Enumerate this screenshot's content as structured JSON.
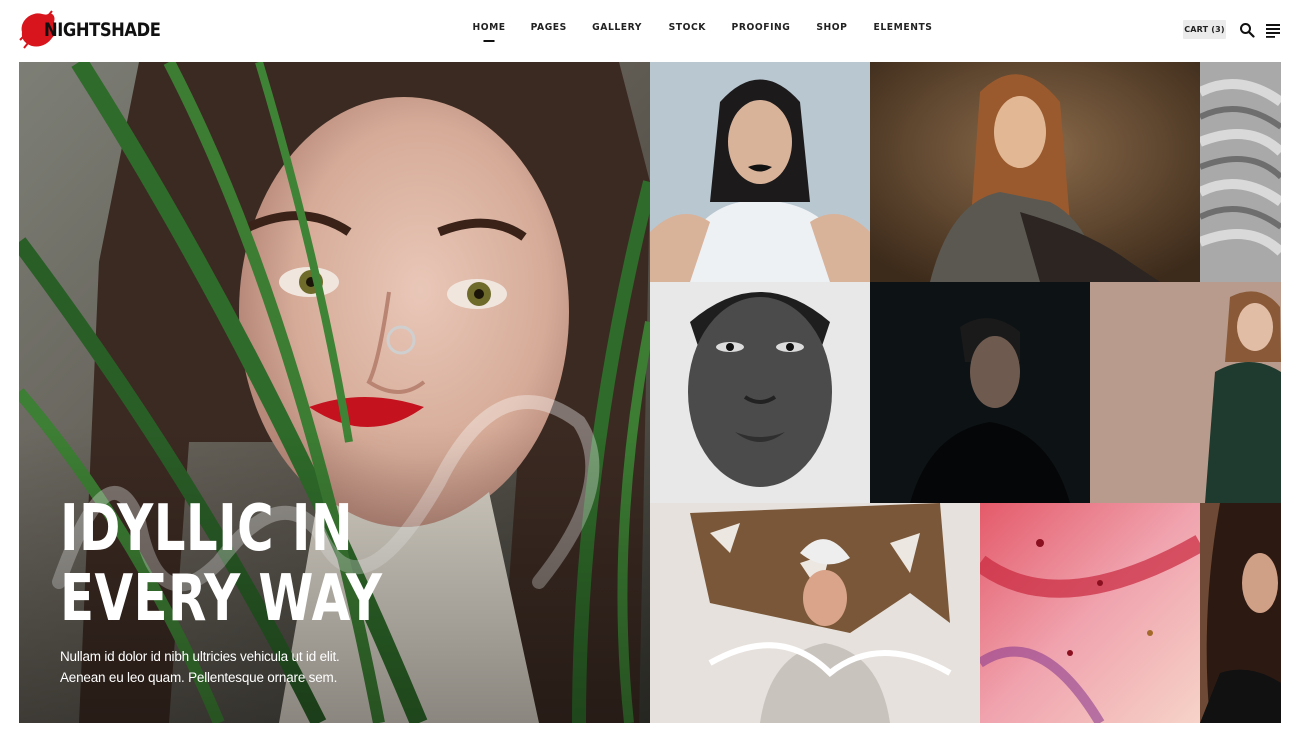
{
  "brand": {
    "name": "NIGHTSHADE",
    "logo_color": "#d8141c"
  },
  "nav": {
    "items": [
      {
        "label": "HOME",
        "active": true
      },
      {
        "label": "PAGES",
        "active": false
      },
      {
        "label": "GALLERY",
        "active": false
      },
      {
        "label": "STOCK",
        "active": false
      },
      {
        "label": "PROOFING",
        "active": false
      },
      {
        "label": "SHOP",
        "active": false
      },
      {
        "label": "ELEMENTS",
        "active": false
      }
    ]
  },
  "header_actions": {
    "cart_label": "CART (3)",
    "search_icon": "search-icon",
    "menu_icon": "hamburger-menu-icon"
  },
  "hero": {
    "title_line1": "IDYLLIC IN",
    "title_line2": "EVERY WAY",
    "subtitle_line1": "Nullam id dolor id nibh ultricies vehicula ut id elit.",
    "subtitle_line2": "Aenean eu leo quam. Pellentesque ornare sem."
  },
  "colors": {
    "text": "#1a1a1a",
    "cart_bg": "#ebebeb",
    "accent": "#d8141c"
  }
}
